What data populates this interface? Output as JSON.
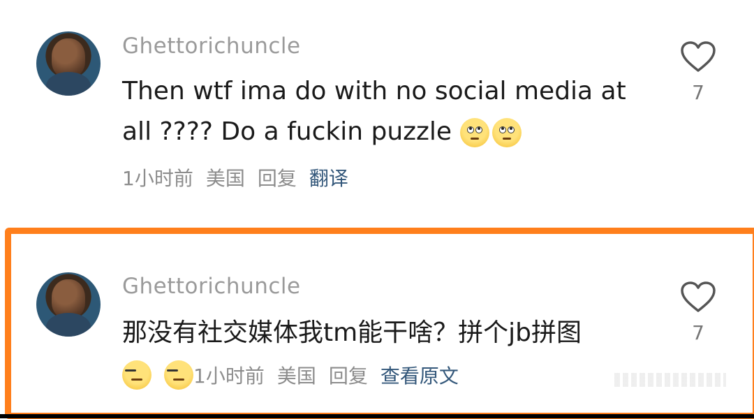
{
  "comments": [
    {
      "username": "Ghettorichuncle",
      "text_line1": "Then wtf ima do with no social media at",
      "text_line2": "all ???? Do a fuckin puzzle",
      "emojis": [
        "eye-roll-emoji",
        "eye-roll-emoji"
      ],
      "time": "1小时前",
      "location": "美国",
      "reply": "回复",
      "translate": "翻译",
      "likes": "7"
    },
    {
      "username": "Ghettorichuncle",
      "text": "那没有社交媒体我tm能干啥？拼个jb拼图",
      "emojis": [
        "expressionless-emoji",
        "expressionless-emoji"
      ],
      "time": "1小时前",
      "location": "美国",
      "reply": "回复",
      "view_original": "查看原文",
      "likes": "7"
    }
  ],
  "colors": {
    "highlight": "#ff7f1c",
    "link": "#33577a",
    "username": "#9a9a9a"
  },
  "icons": {
    "like": "heart-outline-icon"
  }
}
